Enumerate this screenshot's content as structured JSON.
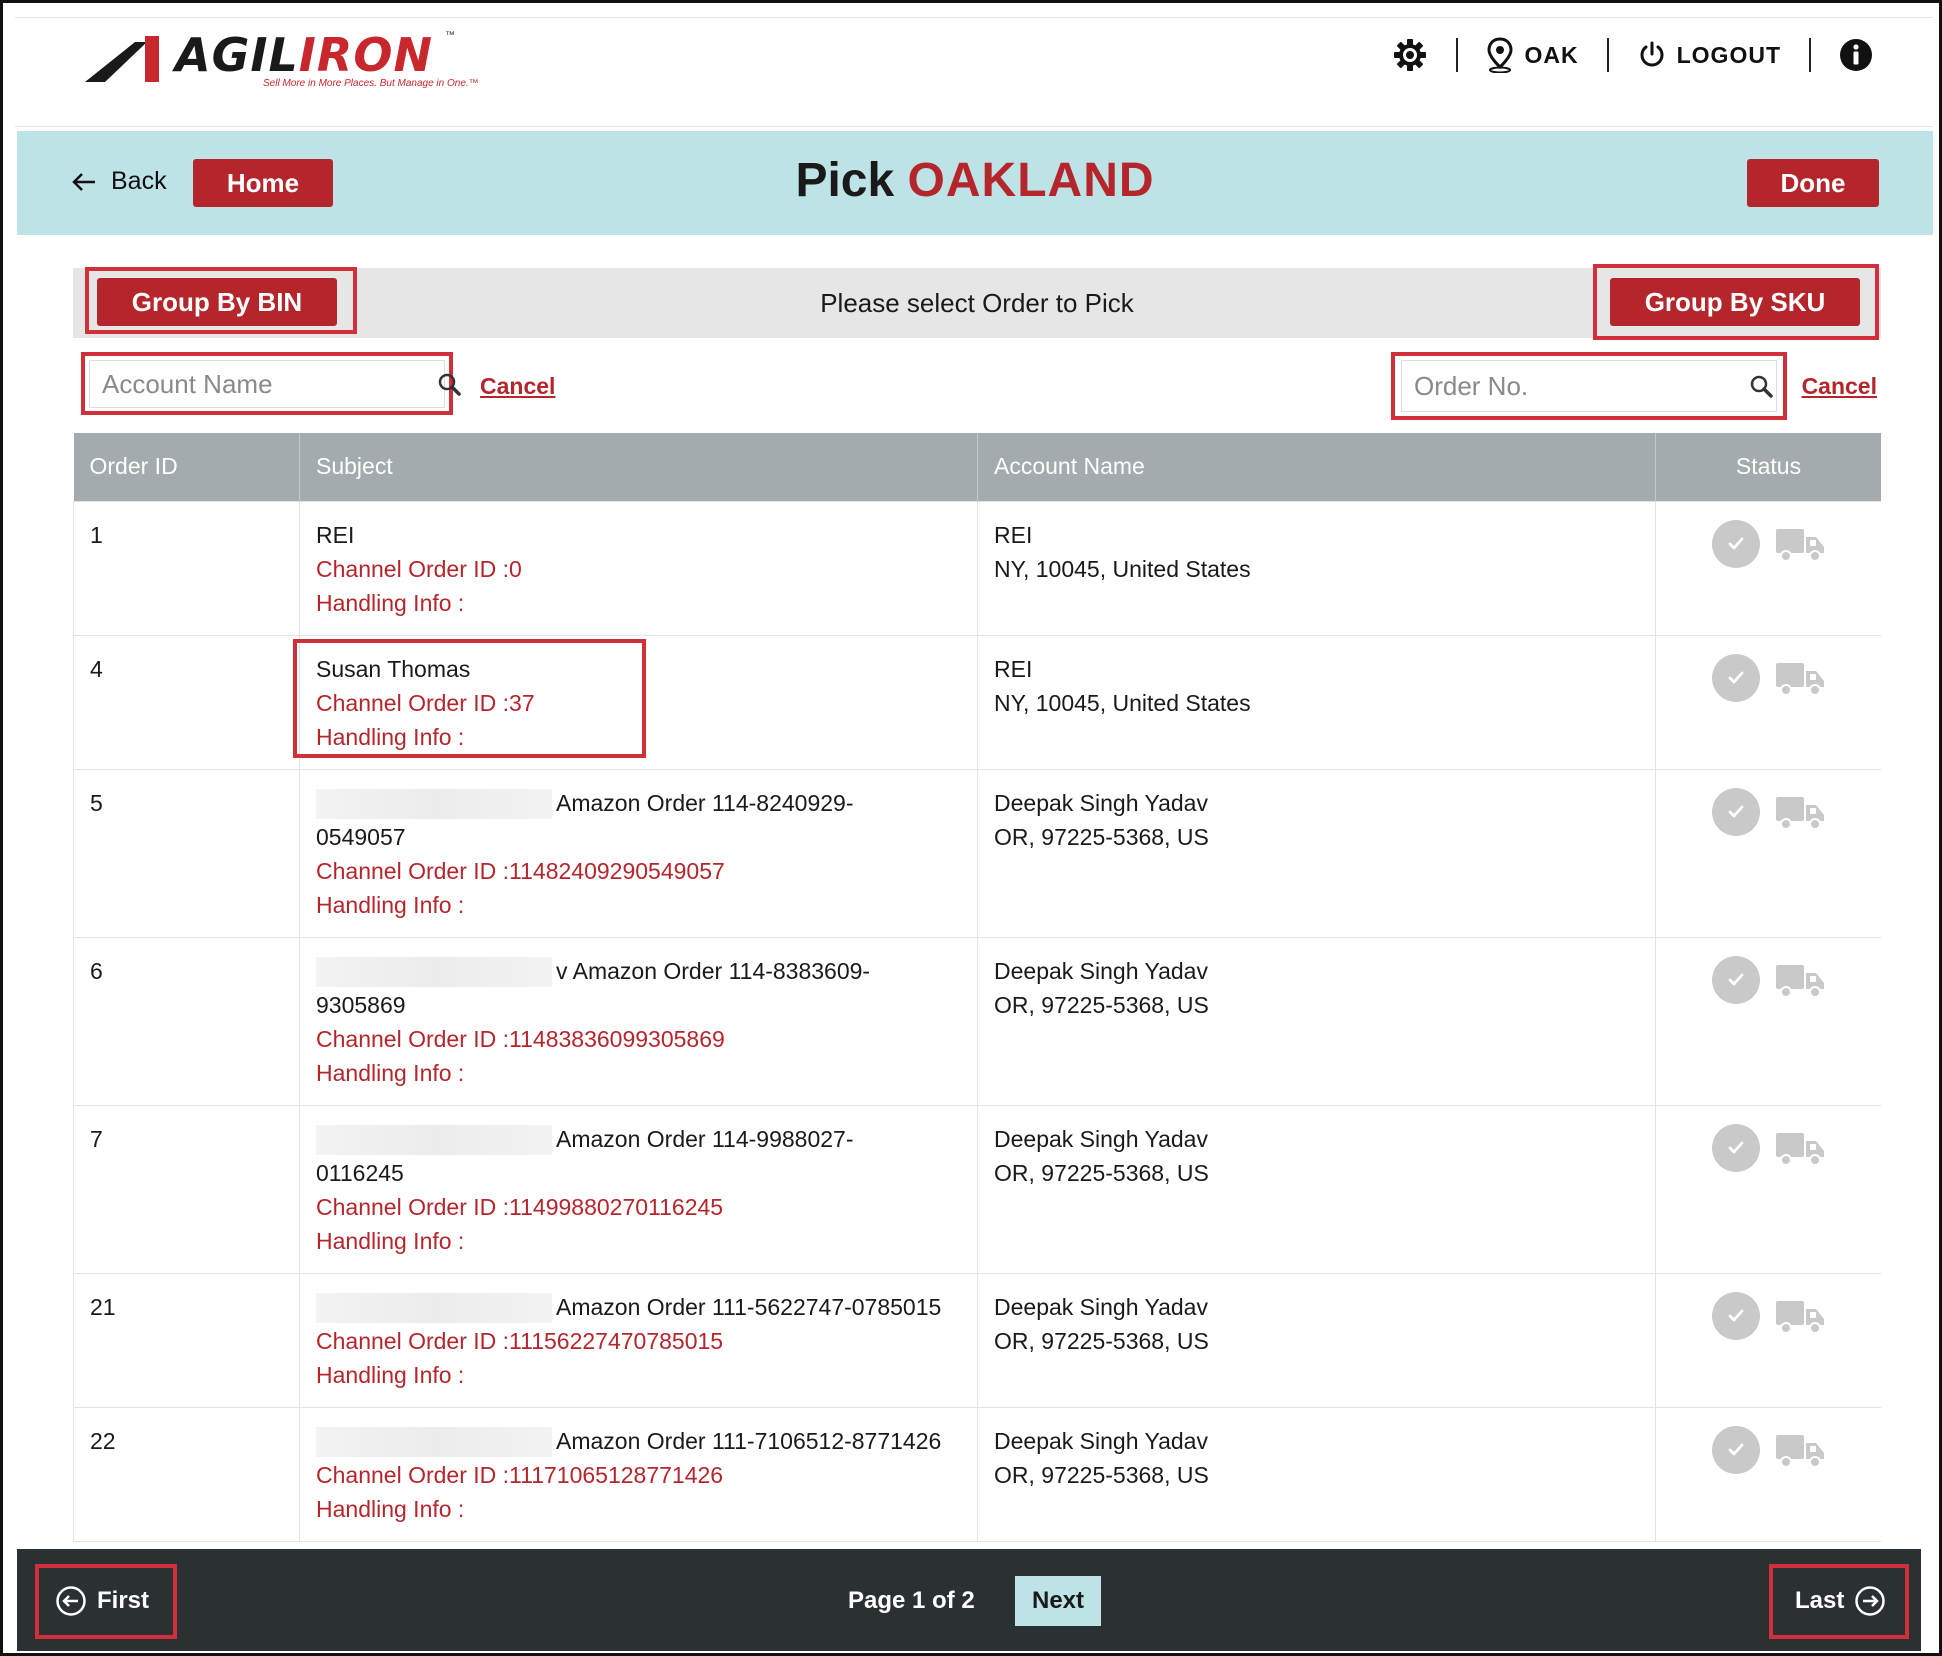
{
  "brand": {
    "name_dark": "AGIL",
    "name_red": "IRON",
    "tm": "™",
    "tagline": "Sell More in More Places. But Manage in One.™"
  },
  "topnav": {
    "location": "OAK",
    "logout": "LOGOUT"
  },
  "header": {
    "back_label": "Back",
    "home_label": "Home",
    "title_prefix": "Pick",
    "title_location": "OAKLAND",
    "done_label": "Done"
  },
  "grouping": {
    "by_bin_label": "Group By BIN",
    "message": "Please select Order to Pick",
    "by_sku_label": "Group By SKU"
  },
  "search": {
    "account_placeholder": "Account Name",
    "account_cancel": "Cancel",
    "order_placeholder": "Order No.",
    "order_cancel": "Cancel"
  },
  "table": {
    "headers": [
      "Order ID",
      "Subject",
      "Account Name",
      "Status"
    ],
    "rows": [
      {
        "order_id": "1",
        "subject_line1": "REI",
        "subject_line2": "",
        "channel": "Channel Order ID :0",
        "handling": "Handling Info :",
        "account_name": "REI",
        "account_addr": "NY, 10045, United States"
      },
      {
        "order_id": "4",
        "subject_line1": "Susan Thomas",
        "subject_line2": "",
        "channel": "Channel Order ID :37",
        "handling": "Handling Info :",
        "account_name": "REI",
        "account_addr": "NY, 10045, United States"
      },
      {
        "order_id": "5",
        "subject_line1": "Amazon Order 114-8240929-",
        "subject_line2": "0549057",
        "channel": "Channel Order ID :11482409290549057",
        "handling": "Handling Info :",
        "account_name": "Deepak Singh Yadav",
        "account_addr": "OR, 97225-5368, US"
      },
      {
        "order_id": "6",
        "subject_line1": "v Amazon Order 114-8383609-",
        "subject_line2": "9305869",
        "channel": "Channel Order ID :11483836099305869",
        "handling": "Handling Info :",
        "account_name": "Deepak Singh Yadav",
        "account_addr": "OR, 97225-5368, US"
      },
      {
        "order_id": "7",
        "subject_line1": "Amazon Order 114-9988027-",
        "subject_line2": "0116245",
        "channel": "Channel Order ID :11499880270116245",
        "handling": "Handling Info :",
        "account_name": "Deepak Singh Yadav",
        "account_addr": "OR, 97225-5368, US"
      },
      {
        "order_id": "21",
        "subject_line1": "Amazon Order 111-5622747-0785015",
        "subject_line2": "",
        "channel": "Channel Order ID :11156227470785015",
        "handling": "Handling Info :",
        "account_name": "Deepak Singh Yadav",
        "account_addr": "OR, 97225-5368, US"
      },
      {
        "order_id": "22",
        "subject_line1": "Amazon Order 111-7106512-8771426",
        "subject_line2": "",
        "channel": "Channel Order ID :11171065128771426",
        "handling": "Handling Info :",
        "account_name": "Deepak Singh Yadav",
        "account_addr": "OR, 97225-5368, US"
      }
    ]
  },
  "pagination": {
    "first_label": "First",
    "info": "Page 1 of 2",
    "next_label": "Next",
    "last_label": "Last"
  },
  "colors": {
    "brand_red": "#b5262c",
    "header_band": "#bde3e6",
    "table_header": "#a4abae",
    "footer": "#2b3132",
    "highlight": "#d0303a"
  },
  "icons": [
    "settings-gear-icon",
    "location-pin-icon",
    "power-icon",
    "info-icon",
    "back-arrow-icon",
    "search-icon",
    "check-circle-icon",
    "truck-icon",
    "arrow-left-circle-icon",
    "arrow-right-circle-icon"
  ]
}
